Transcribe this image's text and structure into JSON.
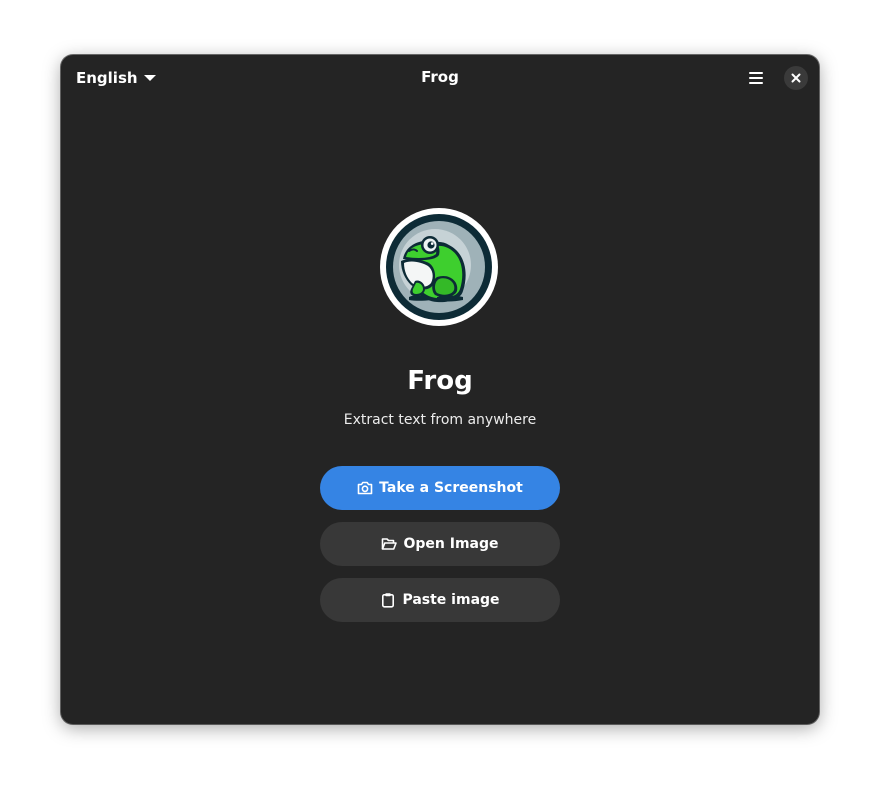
{
  "window": {
    "title": "Frog"
  },
  "header": {
    "language": {
      "selected": "English"
    }
  },
  "main": {
    "app_name": "Frog",
    "tagline": "Extract text from anywhere",
    "buttons": {
      "screenshot": "Take a Screenshot",
      "open_image": "Open Image",
      "paste_image": "Paste image"
    }
  },
  "icons": {
    "dropdown": "chevron-down-icon",
    "menu": "hamburger-menu-icon",
    "close": "close-icon",
    "screenshot": "camera-icon",
    "open": "folder-open-icon",
    "paste": "clipboard-icon",
    "logo": "frog-logo"
  },
  "colors": {
    "window_bg": "#242424",
    "accent": "#3584e4",
    "button_bg": "#383838",
    "frog_green": "#3ecf2e"
  }
}
